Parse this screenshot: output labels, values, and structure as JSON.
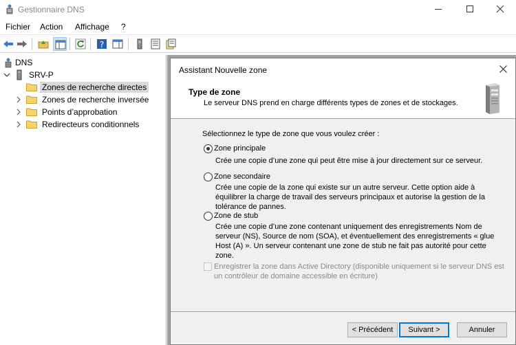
{
  "window": {
    "title": "Gestionnaire DNS",
    "controls": {
      "minimize_icon": "minimize-icon",
      "maximize_icon": "maximize-icon",
      "close_icon": "close-icon"
    }
  },
  "menu": [
    "Fichier",
    "Action",
    "Affichage",
    "?"
  ],
  "toolbar": {
    "buttons": [
      "back-icon",
      "forward-icon",
      "up-folder-icon",
      "show-hide-tree-icon",
      "refresh-icon",
      "help-icon",
      "properties-pane-icon",
      "server-icon",
      "list-icon",
      "export-icon"
    ],
    "pressed_button": "show-hide-tree-icon"
  },
  "tree": {
    "root": "DNS",
    "server": "SRV-P",
    "items": [
      {
        "label": "Zones de recherche directes",
        "selected": true
      },
      {
        "label": "Zones de recherche inversée",
        "selected": false
      },
      {
        "label": "Points d’approbation",
        "selected": false
      },
      {
        "label": "Redirecteurs conditionnels",
        "selected": false
      }
    ]
  },
  "wizard": {
    "title": "Assistant Nouvelle zone",
    "header_title": "Type de zone",
    "header_desc": "Le serveur DNS prend en charge différents types de zones et de stockages.",
    "prompt": "Sélectionnez le type de zone que vous voulez créer :",
    "options": [
      {
        "label": "Zone principale",
        "checked": true,
        "desc": [
          "Crée une copie d’une zone qui peut être mise à jour directement sur ce serveur."
        ]
      },
      {
        "label": "Zone secondaire",
        "checked": false,
        "desc": [
          "Crée une copie de la zone qui existe sur un autre serveur. Cette option aide à",
          "équilibrer la charge de travail des serveurs principaux et autorise la gestion de la",
          "tolérance de pannes."
        ]
      },
      {
        "label": "Zone de stub",
        "checked": false,
        "desc": [
          "Crée une copie d’une zone contenant uniquement des enregistrements Nom de",
          "serveur (NS), Source de nom (SOA), et éventuellement des enregistrements « glue",
          "Host (A) ». Un serveur contenant une zone de stub ne fait pas autorité pour cette",
          "zone."
        ]
      }
    ],
    "ad_checkbox": {
      "checked": false,
      "enabled": false,
      "lines": [
        "Enregistrer la zone dans Active Directory (disponible uniquement si le serveur DNS est",
        "un contrôleur de domaine accessible en écriture)"
      ]
    },
    "buttons": {
      "back": "< Précédent",
      "next": "Suivant >",
      "cancel": "Annuler"
    }
  },
  "colors": {
    "accent": "#0078d7",
    "selection": "#d9d9d9",
    "dialog_bg": "#f0f0f0",
    "mdi_bg": "#a0a0a0"
  }
}
